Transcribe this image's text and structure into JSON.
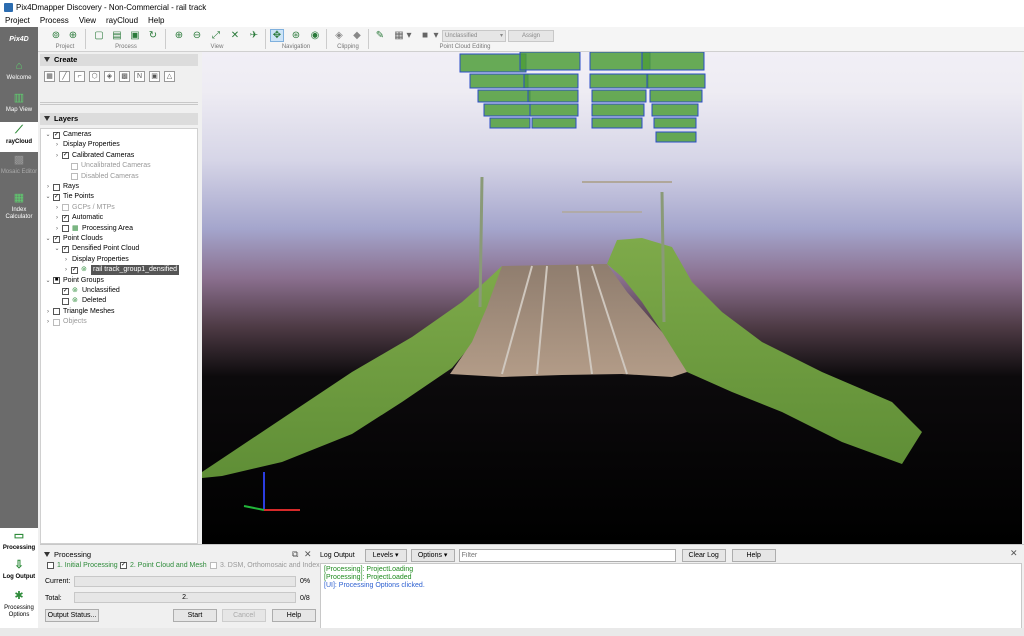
{
  "window": {
    "title": "Pix4Dmapper Discovery - Non-Commercial - rail track"
  },
  "menu": [
    "Project",
    "Process",
    "View",
    "rayCloud",
    "Help"
  ],
  "toolbar": {
    "groups": [
      "Project",
      "Process",
      "View",
      "Navigation",
      "Clipping",
      "Point Cloud Editing"
    ],
    "class_select": "Unclassified",
    "assign_label": "Assign"
  },
  "nav": {
    "logo": "Pix4D",
    "items": [
      "Welcome",
      "Map View",
      "rayCloud",
      "Mosaic Editor",
      "Index Calculator"
    ],
    "lower": [
      "Processing",
      "Log Output",
      "Processing Options"
    ]
  },
  "create": {
    "header": "Create"
  },
  "layers": {
    "header": "Layers",
    "rows": [
      {
        "label": "Cameras",
        "arrow": "v",
        "check": "x"
      },
      {
        "label": "Display Properties",
        "arrow": ">"
      },
      {
        "label": "Calibrated Cameras",
        "arrow": ">",
        "check": "x"
      },
      {
        "label": "Uncalibrated Cameras",
        "check": "d"
      },
      {
        "label": "Disabled Cameras",
        "check": "d"
      },
      {
        "label": "Rays",
        "arrow": ">",
        "check": "o"
      },
      {
        "label": "Tie Points",
        "arrow": "v",
        "check": "x"
      },
      {
        "label": "GCPs / MTPs",
        "arrow": ">",
        "check": "d"
      },
      {
        "label": "Automatic",
        "arrow": ">",
        "check": "x"
      },
      {
        "label": "Processing Area",
        "arrow": ">",
        "check": "o"
      },
      {
        "label": "Point Clouds",
        "arrow": "v",
        "check": "x"
      },
      {
        "label": "Densified Point Cloud",
        "arrow": "v",
        "check": "x"
      },
      {
        "label": "Display Properties",
        "arrow": ">"
      },
      {
        "label": "rail track_group1_densified",
        "arrow": ">",
        "check": "x"
      },
      {
        "label": "Point Groups",
        "arrow": "v",
        "check": "s"
      },
      {
        "label": "Unclassified",
        "check": "x"
      },
      {
        "label": "Deleted",
        "check": "o"
      },
      {
        "label": "Triangle Meshes",
        "arrow": ">",
        "check": "o"
      },
      {
        "label": "Objects",
        "arrow": ">",
        "check": "d"
      }
    ]
  },
  "processing": {
    "header": "Processing",
    "steps": [
      "1. Initial Processing",
      "2. Point Cloud and Mesh",
      "3. DSM, Orthomosaic and Index"
    ],
    "current_label": "Current:",
    "current_pct": "0%",
    "total_label": "Total:",
    "total_step": "2.",
    "total_count": "0/8",
    "output_status": "Output Status...",
    "start": "Start",
    "cancel": "Cancel",
    "help": "Help"
  },
  "log": {
    "header": "Log Output",
    "levels": "Levels",
    "options": "Options",
    "filter_placeholder": "Filter",
    "clear": "Clear Log",
    "help": "Help",
    "lines": [
      "[Processing]: ProjectLoading",
      "[Processing]: ProjectLoaded",
      "[UI]: Processing Options clicked."
    ]
  }
}
